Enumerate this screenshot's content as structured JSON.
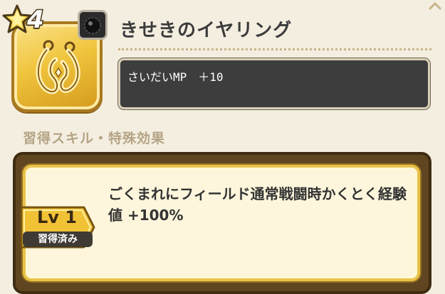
{
  "item": {
    "rarity_stars": "4",
    "name": "きせきのイヤリング",
    "stat_line": "さいだいMP　＋10",
    "icon": "earring-icon",
    "type_icon": "accessory-orb-icon"
  },
  "skills": {
    "section_title": "習得スキル・特殊効果",
    "entries": [
      {
        "level": "Lv 1",
        "status": "習得済み",
        "description": "ごくまれにフィールド通常戦闘時かくとく経験値 +100%"
      }
    ]
  },
  "colors": {
    "background": "#f3eee0",
    "stat_box": "#3d3d3d",
    "skill_panel": "#5f4621",
    "skill_card_border": "#e9c24a",
    "level_tag": "#f2c236"
  }
}
